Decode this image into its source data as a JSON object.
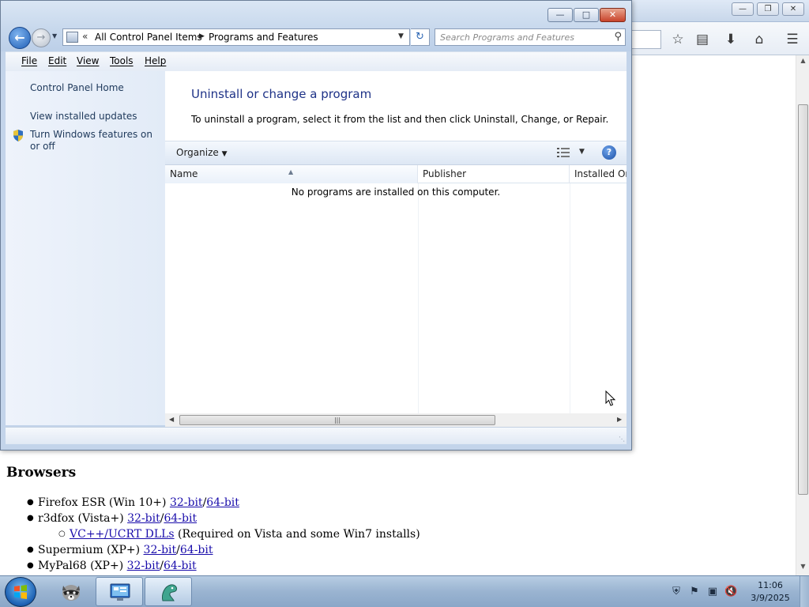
{
  "browser": {
    "content": {
      "heading": "Browsers",
      "items": [
        {
          "text": "Firefox ESR (Win 10+) ",
          "link1": "32-bit",
          "sep": "/",
          "link2": "64-bit"
        },
        {
          "text": "r3dfox (Vista+) ",
          "link1": "32-bit",
          "sep": "/",
          "link2": "64-bit"
        },
        {
          "link": "VC++/UCRT DLLs",
          "text": " (Required on Vista and some Win7 installs)"
        },
        {
          "text": "Supermium (XP+) ",
          "link1": "32-bit",
          "sep": "/",
          "link2": "64-bit"
        },
        {
          "text": "MyPal68 (XP+) ",
          "link1": "32-bit",
          "sep": "/",
          "link2": "64-bit"
        }
      ]
    },
    "toolbar_icons": [
      "star-icon",
      "reading-list-icon",
      "download-icon",
      "home-icon",
      "menu-icon"
    ]
  },
  "window": {
    "address": {
      "overflow": "«",
      "crumbs": [
        "All Control Panel Items",
        "Programs and Features"
      ]
    },
    "search": {
      "placeholder": "Search Programs and Features"
    },
    "menu": [
      "File",
      "Edit",
      "View",
      "Tools",
      "Help"
    ],
    "sidebar": {
      "links": [
        "Control Panel Home",
        "View installed updates",
        "Turn Windows features on or off"
      ]
    },
    "main": {
      "title": "Uninstall or change a program",
      "description": "To uninstall a program, select it from the list and then click Uninstall, Change, or Repair.",
      "organize": "Organize",
      "columns": [
        "Name",
        "Publisher",
        "Installed On"
      ],
      "empty_message": "No programs are installed on this computer."
    }
  },
  "taskbar": {
    "apps": [
      "raccoon-app-icon",
      "control-panel-app-icon",
      "dragon-app-icon"
    ],
    "clock": {
      "time": "11:06",
      "date": "3/9/2025"
    }
  },
  "colors": {
    "link": "#1a0dab",
    "title_blue": "#1e3287",
    "sidebar_link": "#1e395b",
    "close_red": "#c8432b"
  }
}
